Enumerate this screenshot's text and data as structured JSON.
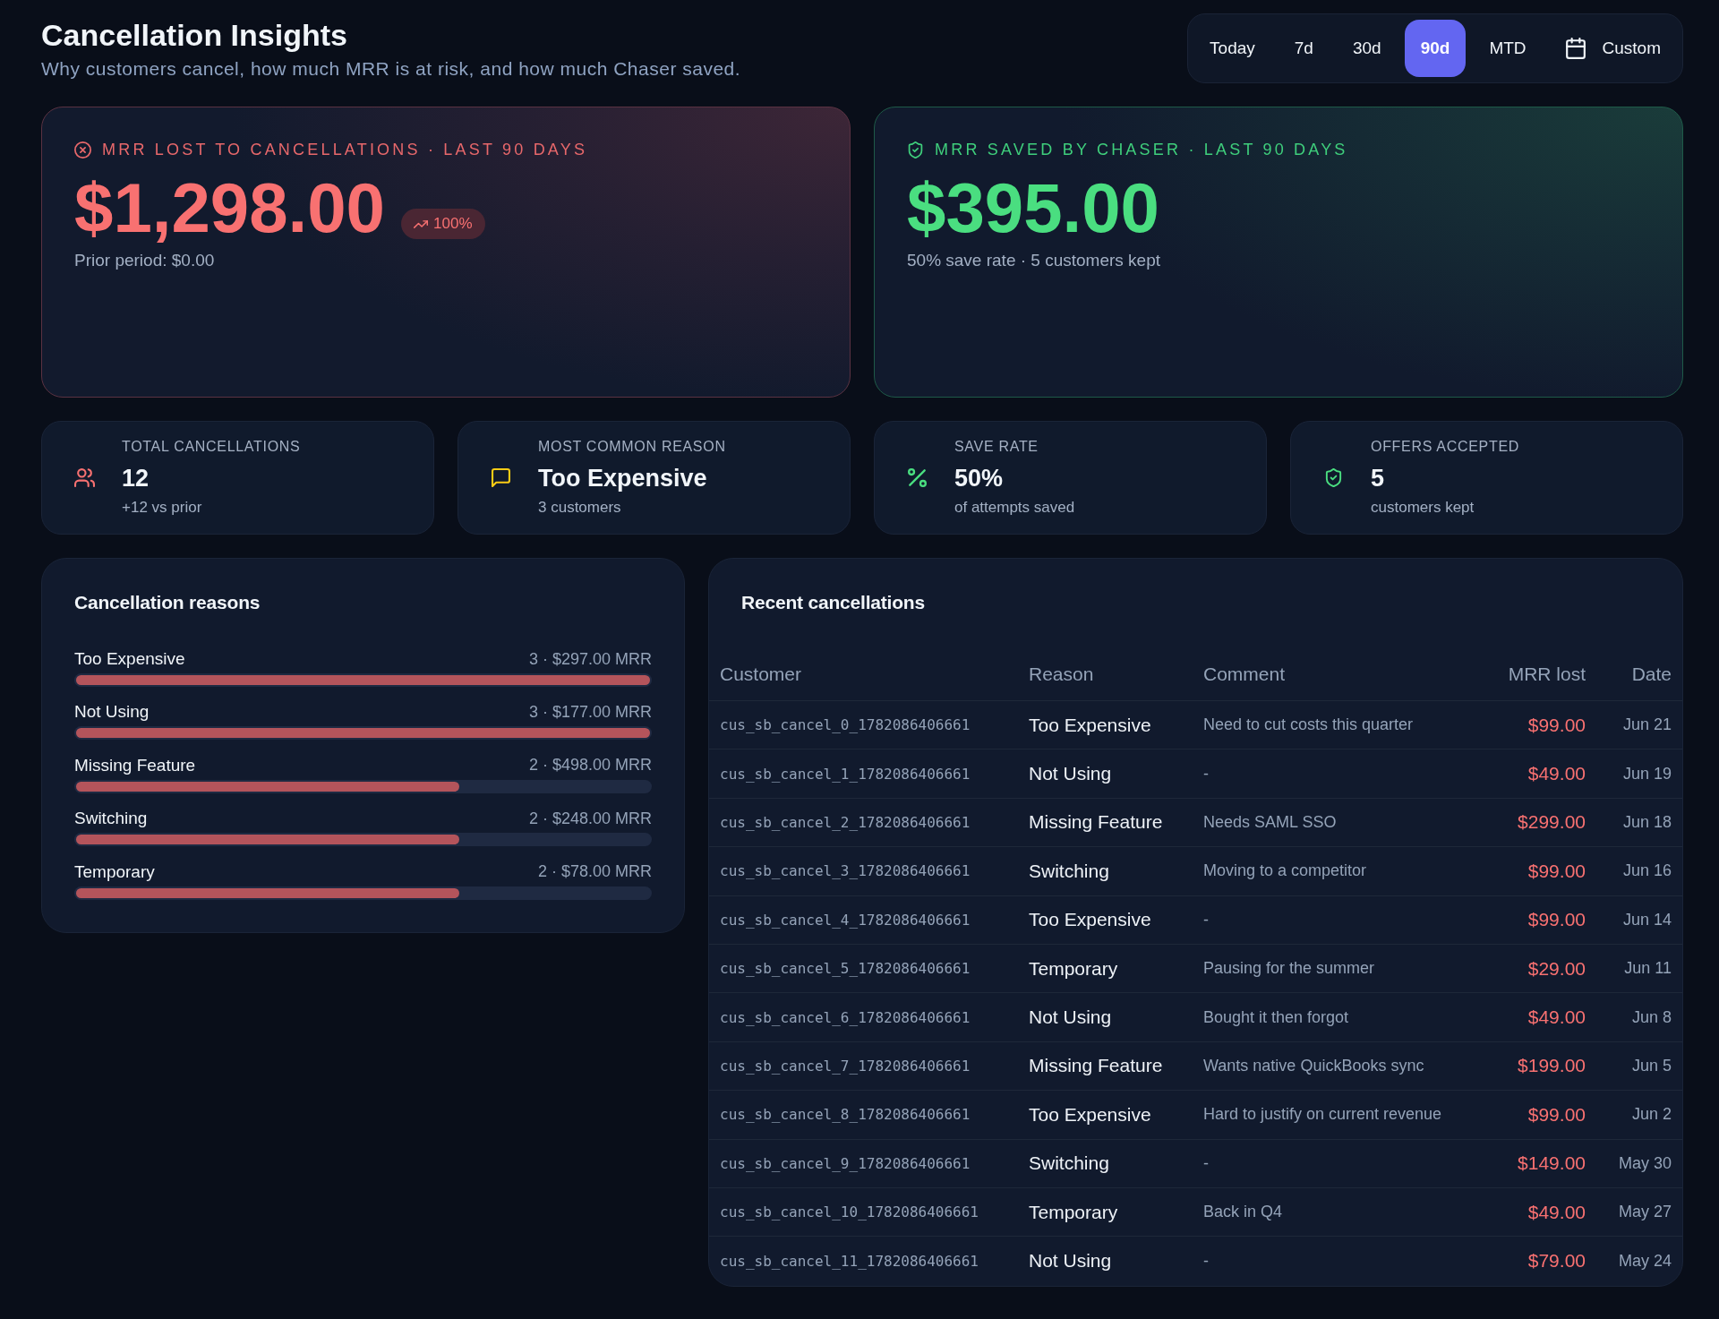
{
  "header": {
    "title": "Cancellation Insights",
    "subtitle": "Why customers cancel, how much MRR is at risk, and how much Chaser saved."
  },
  "range_tabs": [
    {
      "label": "Today",
      "kind": "preset",
      "selected": false
    },
    {
      "label": "7d",
      "kind": "preset",
      "selected": false
    },
    {
      "label": "30d",
      "kind": "preset",
      "selected": false
    },
    {
      "label": "90d",
      "kind": "preset",
      "selected": true
    },
    {
      "label": "MTD",
      "kind": "preset",
      "selected": false
    },
    {
      "label": "Custom",
      "kind": "custom",
      "selected": false
    }
  ],
  "hero_cards": [
    {
      "kind": "lost",
      "label": "MRR LOST TO CANCELLATIONS · LAST 90 DAYS",
      "value": "$1,298.00",
      "change": "100%",
      "note": "Prior period: $0.00"
    },
    {
      "kind": "saved",
      "label": "MRR SAVED BY CHASER · LAST 90 DAYS",
      "value": "$395.00",
      "note": "50% save rate · 5 customers kept"
    }
  ],
  "stat_cards": [
    {
      "kind": "users",
      "label": "TOTAL CANCELLATIONS",
      "value": "12",
      "note": "+12 vs prior"
    },
    {
      "kind": "message",
      "label": "MOST COMMON REASON",
      "value": "Too Expensive",
      "note": "3 customers"
    },
    {
      "kind": "percent",
      "label": "SAVE RATE",
      "value": "50%",
      "note": "of attempts saved"
    },
    {
      "kind": "shield",
      "label": "OFFERS ACCEPTED",
      "value": "5",
      "note": "customers kept"
    }
  ],
  "reasons": {
    "title": "Cancellation reasons",
    "items": [
      {
        "label": "Too Expensive",
        "summary": "3 · $297.00 MRR",
        "level": 1
      },
      {
        "label": "Not Using",
        "summary": "3 · $177.00 MRR",
        "level": 1
      },
      {
        "label": "Missing Feature",
        "summary": "2 · $498.00 MRR",
        "level": 0.667
      },
      {
        "label": "Switching",
        "summary": "2 · $248.00 MRR",
        "level": 0.667
      },
      {
        "label": "Temporary",
        "summary": "2 · $78.00 MRR",
        "level": 0.667
      }
    ]
  },
  "recent_cancellations": {
    "title": "Recent cancellations",
    "columns": [
      "Customer",
      "Reason",
      "Comment",
      "MRR lost",
      "Date"
    ],
    "rows": [
      {
        "customer": "cus_sb_cancel_0_1782086406661",
        "reason": "Too Expensive",
        "comment": "Need to cut costs this quarter",
        "mrr_lost": "$99.00",
        "date": "Jun 21"
      },
      {
        "customer": "cus_sb_cancel_1_1782086406661",
        "reason": "Not Using",
        "comment": "-",
        "mrr_lost": "$49.00",
        "date": "Jun 19"
      },
      {
        "customer": "cus_sb_cancel_2_1782086406661",
        "reason": "Missing Feature",
        "comment": "Needs SAML SSO",
        "mrr_lost": "$299.00",
        "date": "Jun 18"
      },
      {
        "customer": "cus_sb_cancel_3_1782086406661",
        "reason": "Switching",
        "comment": "Moving to a competitor",
        "mrr_lost": "$99.00",
        "date": "Jun 16"
      },
      {
        "customer": "cus_sb_cancel_4_1782086406661",
        "reason": "Too Expensive",
        "comment": "-",
        "mrr_lost": "$99.00",
        "date": "Jun 14"
      },
      {
        "customer": "cus_sb_cancel_5_1782086406661",
        "reason": "Temporary",
        "comment": "Pausing for the summer",
        "mrr_lost": "$29.00",
        "date": "Jun 11"
      },
      {
        "customer": "cus_sb_cancel_6_1782086406661",
        "reason": "Not Using",
        "comment": "Bought it then forgot",
        "mrr_lost": "$49.00",
        "date": "Jun 8"
      },
      {
        "customer": "cus_sb_cancel_7_1782086406661",
        "reason": "Missing Feature",
        "comment": "Wants native QuickBooks sync",
        "mrr_lost": "$199.00",
        "date": "Jun 5"
      },
      {
        "customer": "cus_sb_cancel_8_1782086406661",
        "reason": "Too Expensive",
        "comment": "Hard to justify on current revenue",
        "mrr_lost": "$99.00",
        "date": "Jun 2"
      },
      {
        "customer": "cus_sb_cancel_9_1782086406661",
        "reason": "Switching",
        "comment": "-",
        "mrr_lost": "$149.00",
        "date": "May 30"
      },
      {
        "customer": "cus_sb_cancel_10_1782086406661",
        "reason": "Temporary",
        "comment": "Back in Q4",
        "mrr_lost": "$49.00",
        "date": "May 27"
      },
      {
        "customer": "cus_sb_cancel_11_1782086406661",
        "reason": "Not Using",
        "comment": "-",
        "mrr_lost": "$79.00",
        "date": "May 24"
      }
    ]
  }
}
